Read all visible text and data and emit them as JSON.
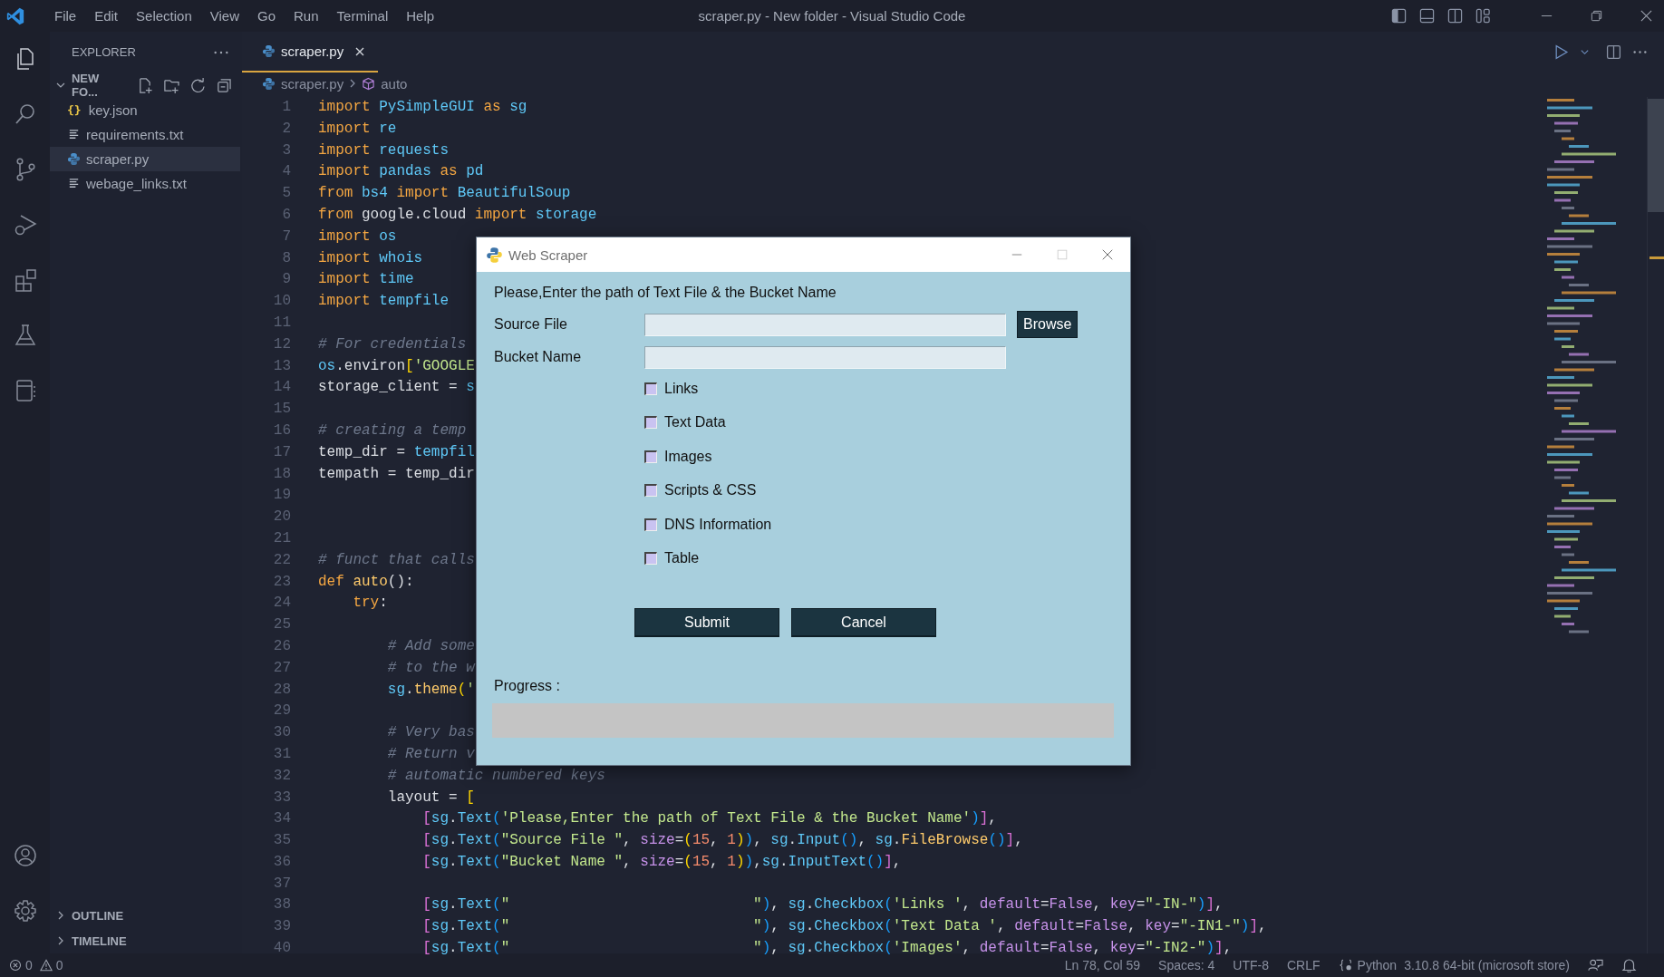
{
  "window": {
    "title": "scraper.py - New folder - Visual Studio Code"
  },
  "menu": [
    "File",
    "Edit",
    "Selection",
    "View",
    "Go",
    "Run",
    "Terminal",
    "Help"
  ],
  "sidebar": {
    "title": "EXPLORER",
    "folder": {
      "name": "NEW FO...",
      "expanded": true
    },
    "files": [
      {
        "name": "key.json",
        "kind": "json",
        "glyph": "{}",
        "selected": false
      },
      {
        "name": "requirements.txt",
        "kind": "txt",
        "selected": false
      },
      {
        "name": "scraper.py",
        "kind": "py",
        "selected": true
      },
      {
        "name": "webage_links.txt",
        "kind": "txt",
        "selected": false
      }
    ],
    "sections": [
      {
        "label": "OUTLINE",
        "expanded": false
      },
      {
        "label": "TIMELINE",
        "expanded": false
      }
    ]
  },
  "tabs": [
    {
      "label": "scraper.py",
      "selected": true
    }
  ],
  "breadcrumb": [
    "scraper.py",
    "auto"
  ],
  "code": [
    {
      "n": "1",
      "tokens": [
        {
          "text": "import",
          "kind": "kw"
        },
        {
          "text": " PySimpleGUI ",
          "kind": "mod"
        },
        {
          "text": "as",
          "kind": "kw"
        },
        {
          "text": " sg",
          "kind": "mod"
        }
      ]
    },
    {
      "n": "2",
      "tokens": [
        {
          "text": "import",
          "kind": "kw"
        },
        {
          "text": " re",
          "kind": "mod"
        }
      ]
    },
    {
      "n": "3",
      "tokens": [
        {
          "text": "import",
          "kind": "kw"
        },
        {
          "text": " requests",
          "kind": "mod"
        }
      ]
    },
    {
      "n": "4",
      "tokens": [
        {
          "text": "import",
          "kind": "kw"
        },
        {
          "text": " pandas ",
          "kind": "mod"
        },
        {
          "text": "as",
          "kind": "kw"
        },
        {
          "text": " pd",
          "kind": "mod"
        }
      ]
    },
    {
      "n": "5",
      "tokens": [
        {
          "text": "from",
          "kind": "kw"
        },
        {
          "text": " bs4 ",
          "kind": "mod"
        },
        {
          "text": "import",
          "kind": "kw"
        },
        {
          "text": " BeautifulSoup",
          "kind": "mod"
        }
      ]
    },
    {
      "n": "6",
      "tokens": [
        {
          "text": "from",
          "kind": "kw"
        },
        {
          "text": " google.cloud ",
          "kind": "pl"
        },
        {
          "text": "import",
          "kind": "kw"
        },
        {
          "text": " storage",
          "kind": "mod"
        }
      ]
    },
    {
      "n": "7",
      "tokens": [
        {
          "text": "import",
          "kind": "kw"
        },
        {
          "text": " os",
          "kind": "mod"
        }
      ]
    },
    {
      "n": "8",
      "tokens": [
        {
          "text": "import",
          "kind": "kw"
        },
        {
          "text": " whois",
          "kind": "mod"
        }
      ]
    },
    {
      "n": "9",
      "tokens": [
        {
          "text": "import",
          "kind": "kw"
        },
        {
          "text": " time",
          "kind": "mod"
        }
      ]
    },
    {
      "n": "10",
      "tokens": [
        {
          "text": "import",
          "kind": "kw"
        },
        {
          "text": " tempfile",
          "kind": "mod"
        }
      ]
    },
    {
      "n": "11"
    },
    {
      "n": "12",
      "tokens": [
        {
          "text": "# For credentials",
          "kind": "cm"
        }
      ]
    },
    {
      "n": "13",
      "tokens": [
        {
          "text": "os",
          "kind": "mod"
        },
        {
          "text": ".environ",
          "kind": "pl"
        },
        {
          "text": "[",
          "kind": "b2"
        },
        {
          "text": "'GOOGLE",
          "kind": "str"
        }
      ]
    },
    {
      "n": "14",
      "tokens": [
        {
          "text": "storage_client = ",
          "kind": "pl"
        },
        {
          "text": "s",
          "kind": "mod"
        }
      ]
    },
    {
      "n": "15"
    },
    {
      "n": "16",
      "tokens": [
        {
          "text": "# creating a temp",
          "kind": "cm"
        }
      ]
    },
    {
      "n": "17",
      "tokens": [
        {
          "text": "temp_dir = ",
          "kind": "pl"
        },
        {
          "text": "tempfil",
          "kind": "mod"
        }
      ]
    },
    {
      "n": "18",
      "tokens": [
        {
          "text": "tempath = temp_dir",
          "kind": "pl"
        }
      ]
    },
    {
      "n": "19"
    },
    {
      "n": "20"
    },
    {
      "n": "21"
    },
    {
      "n": "22",
      "tokens": [
        {
          "text": "# funct that calls",
          "kind": "cm"
        }
      ]
    },
    {
      "n": "23",
      "tokens": [
        {
          "text": "def ",
          "kind": "kw"
        },
        {
          "text": "auto",
          "kind": "fn"
        },
        {
          "text": "():",
          "kind": "pl"
        }
      ]
    },
    {
      "n": "24",
      "tokens": [
        {
          "text": "    try",
          "kind": "kw"
        },
        {
          "text": ":",
          "kind": "pl"
        }
      ]
    },
    {
      "n": "25"
    },
    {
      "n": "26",
      "tokens": [
        {
          "text": "        # Add some",
          "kind": "cm"
        }
      ]
    },
    {
      "n": "27",
      "tokens": [
        {
          "text": "        # to the w",
          "kind": "cm"
        }
      ]
    },
    {
      "n": "28",
      "tokens": [
        {
          "text": "        sg",
          "kind": "mod"
        },
        {
          "text": ".",
          "kind": "pl"
        },
        {
          "text": "theme",
          "kind": "fn"
        },
        {
          "text": "(",
          "kind": "b2"
        },
        {
          "text": "'",
          "kind": "str"
        }
      ]
    },
    {
      "n": "29"
    },
    {
      "n": "30",
      "tokens": [
        {
          "text": "        # Very bas",
          "kind": "cm"
        }
      ]
    },
    {
      "n": "31",
      "tokens": [
        {
          "text": "        # Return v",
          "kind": "cm"
        }
      ]
    },
    {
      "n": "32",
      "tokens": [
        {
          "text": "        # automatic numbered keys",
          "kind": "cm"
        }
      ]
    },
    {
      "n": "33",
      "tokens": [
        {
          "text": "        layout = ",
          "kind": "pl"
        },
        {
          "text": "[",
          "kind": "b2"
        }
      ]
    },
    {
      "n": "34",
      "tokens": [
        {
          "text": "            [",
          "kind": "b1"
        },
        {
          "text": "sg",
          "kind": "mod"
        },
        {
          "text": ".",
          "kind": "pl"
        },
        {
          "text": "Text",
          "kind": "mod"
        },
        {
          "text": "(",
          "kind": "b3"
        },
        {
          "text": "'Please,Enter the path of Text File & the Bucket Name'",
          "kind": "str"
        },
        {
          "text": ")",
          "kind": "b3"
        },
        {
          "text": "]",
          "kind": "b1"
        },
        {
          "text": ",",
          "kind": "pl"
        }
      ]
    },
    {
      "n": "35",
      "tokens": [
        {
          "text": "            [",
          "kind": "b1"
        },
        {
          "text": "sg",
          "kind": "mod"
        },
        {
          "text": ".",
          "kind": "pl"
        },
        {
          "text": "Text",
          "kind": "mod"
        },
        {
          "text": "(",
          "kind": "b3"
        },
        {
          "text": "\"Source File \"",
          "kind": "str"
        },
        {
          "text": ", ",
          "kind": "pl"
        },
        {
          "text": "size",
          "kind": "par"
        },
        {
          "text": "=",
          "kind": "pl"
        },
        {
          "text": "(",
          "kind": "b2"
        },
        {
          "text": "15",
          "kind": "num"
        },
        {
          "text": ", ",
          "kind": "pl"
        },
        {
          "text": "1",
          "kind": "num"
        },
        {
          "text": ")",
          "kind": "b2"
        },
        {
          "text": ")",
          "kind": "b3"
        },
        {
          "text": ", ",
          "kind": "pl"
        },
        {
          "text": "sg",
          "kind": "mod"
        },
        {
          "text": ".",
          "kind": "pl"
        },
        {
          "text": "Input",
          "kind": "mod"
        },
        {
          "text": "()",
          "kind": "b3"
        },
        {
          "text": ", ",
          "kind": "pl"
        },
        {
          "text": "sg",
          "kind": "mod"
        },
        {
          "text": ".",
          "kind": "pl"
        },
        {
          "text": "FileBrowse",
          "kind": "fn"
        },
        {
          "text": "()",
          "kind": "b3"
        },
        {
          "text": "]",
          "kind": "b1"
        },
        {
          "text": ",",
          "kind": "pl"
        }
      ]
    },
    {
      "n": "36",
      "tokens": [
        {
          "text": "            [",
          "kind": "b1"
        },
        {
          "text": "sg",
          "kind": "mod"
        },
        {
          "text": ".",
          "kind": "pl"
        },
        {
          "text": "Text",
          "kind": "mod"
        },
        {
          "text": "(",
          "kind": "b3"
        },
        {
          "text": "\"Bucket Name \"",
          "kind": "str"
        },
        {
          "text": ", ",
          "kind": "pl"
        },
        {
          "text": "size",
          "kind": "par"
        },
        {
          "text": "=",
          "kind": "pl"
        },
        {
          "text": "(",
          "kind": "b2"
        },
        {
          "text": "15",
          "kind": "num"
        },
        {
          "text": ", ",
          "kind": "pl"
        },
        {
          "text": "1",
          "kind": "num"
        },
        {
          "text": ")",
          "kind": "b2"
        },
        {
          "text": ")",
          "kind": "b3"
        },
        {
          "text": ",",
          "kind": "pl"
        },
        {
          "text": "sg",
          "kind": "mod"
        },
        {
          "text": ".",
          "kind": "pl"
        },
        {
          "text": "InputText",
          "kind": "mod"
        },
        {
          "text": "()",
          "kind": "b3"
        },
        {
          "text": "]",
          "kind": "b1"
        },
        {
          "text": ",",
          "kind": "pl"
        }
      ]
    },
    {
      "n": "37"
    },
    {
      "n": "38",
      "tokens": [
        {
          "text": "            [",
          "kind": "b1"
        },
        {
          "text": "sg",
          "kind": "mod"
        },
        {
          "text": ".",
          "kind": "pl"
        },
        {
          "text": "Text",
          "kind": "mod"
        },
        {
          "text": "(",
          "kind": "b3"
        },
        {
          "text": "\"                            \"",
          "kind": "str"
        },
        {
          "text": ")",
          "kind": "b3"
        },
        {
          "text": ", ",
          "kind": "pl"
        },
        {
          "text": "sg",
          "kind": "mod"
        },
        {
          "text": ".",
          "kind": "pl"
        },
        {
          "text": "Checkbox",
          "kind": "mod"
        },
        {
          "text": "(",
          "kind": "b3"
        },
        {
          "text": "'Links '",
          "kind": "str"
        },
        {
          "text": ", ",
          "kind": "pl"
        },
        {
          "text": "default",
          "kind": "par"
        },
        {
          "text": "=",
          "kind": "pl"
        },
        {
          "text": "False",
          "kind": "par"
        },
        {
          "text": ", ",
          "kind": "pl"
        },
        {
          "text": "key",
          "kind": "par"
        },
        {
          "text": "=",
          "kind": "pl"
        },
        {
          "text": "\"-IN-\"",
          "kind": "str"
        },
        {
          "text": ")",
          "kind": "b3"
        },
        {
          "text": "]",
          "kind": "b1"
        },
        {
          "text": ",",
          "kind": "pl"
        }
      ]
    },
    {
      "n": "39",
      "tokens": [
        {
          "text": "            [",
          "kind": "b1"
        },
        {
          "text": "sg",
          "kind": "mod"
        },
        {
          "text": ".",
          "kind": "pl"
        },
        {
          "text": "Text",
          "kind": "mod"
        },
        {
          "text": "(",
          "kind": "b3"
        },
        {
          "text": "\"                            \"",
          "kind": "str"
        },
        {
          "text": ")",
          "kind": "b3"
        },
        {
          "text": ", ",
          "kind": "pl"
        },
        {
          "text": "sg",
          "kind": "mod"
        },
        {
          "text": ".",
          "kind": "pl"
        },
        {
          "text": "Checkbox",
          "kind": "mod"
        },
        {
          "text": "(",
          "kind": "b3"
        },
        {
          "text": "'Text Data '",
          "kind": "str"
        },
        {
          "text": ", ",
          "kind": "pl"
        },
        {
          "text": "default",
          "kind": "par"
        },
        {
          "text": "=",
          "kind": "pl"
        },
        {
          "text": "False",
          "kind": "par"
        },
        {
          "text": ", ",
          "kind": "pl"
        },
        {
          "text": "key",
          "kind": "par"
        },
        {
          "text": "=",
          "kind": "pl"
        },
        {
          "text": "\"-IN1-\"",
          "kind": "str"
        },
        {
          "text": ")",
          "kind": "b3"
        },
        {
          "text": "]",
          "kind": "b1"
        },
        {
          "text": ",",
          "kind": "pl"
        }
      ]
    },
    {
      "n": "40",
      "tokens": [
        {
          "text": "            [",
          "kind": "b1"
        },
        {
          "text": "sg",
          "kind": "mod"
        },
        {
          "text": ".",
          "kind": "pl"
        },
        {
          "text": "Text",
          "kind": "mod"
        },
        {
          "text": "(",
          "kind": "b3"
        },
        {
          "text": "\"                            \"",
          "kind": "str"
        },
        {
          "text": ")",
          "kind": "b3"
        },
        {
          "text": ", ",
          "kind": "pl"
        },
        {
          "text": "sg",
          "kind": "mod"
        },
        {
          "text": ".",
          "kind": "pl"
        },
        {
          "text": "Checkbox",
          "kind": "mod"
        },
        {
          "text": "(",
          "kind": "b3"
        },
        {
          "text": "'Images'",
          "kind": "str"
        },
        {
          "text": ", ",
          "kind": "pl"
        },
        {
          "text": "default",
          "kind": "par"
        },
        {
          "text": "=",
          "kind": "pl"
        },
        {
          "text": "False",
          "kind": "par"
        },
        {
          "text": ", ",
          "kind": "pl"
        },
        {
          "text": "key",
          "kind": "par"
        },
        {
          "text": "=",
          "kind": "pl"
        },
        {
          "text": "\"-IN2-\"",
          "kind": "str"
        },
        {
          "text": ")",
          "kind": "b3"
        },
        {
          "text": "]",
          "kind": "b1"
        },
        {
          "text": ",",
          "kind": "pl"
        }
      ]
    }
  ],
  "dialog": {
    "title": "Web Scraper",
    "prompt": "Please,Enter the path of Text File & the Bucket Name",
    "fields": [
      {
        "label": "Source File",
        "button": "Browse"
      },
      {
        "label": "Bucket Name"
      }
    ],
    "checkboxes": [
      {
        "label": "Links",
        "checked": false
      },
      {
        "label": "Text Data",
        "checked": false
      },
      {
        "label": "Images",
        "checked": false
      },
      {
        "label": "Scripts & CSS",
        "checked": false
      },
      {
        "label": "DNS Information",
        "checked": false
      },
      {
        "label": "Table",
        "checked": false
      }
    ],
    "buttons": [
      "Submit",
      "Cancel"
    ],
    "progress": {
      "label": "Progress :",
      "level": 0
    }
  },
  "status_bar": {
    "errors": "0",
    "warnings": "0",
    "items": [
      "Ln 78, Col 59",
      "Spaces: 4",
      "UTF-8",
      "CRLF"
    ],
    "language": "Python",
    "interpreter": "3.10.8 64-bit (microsoft store)"
  }
}
